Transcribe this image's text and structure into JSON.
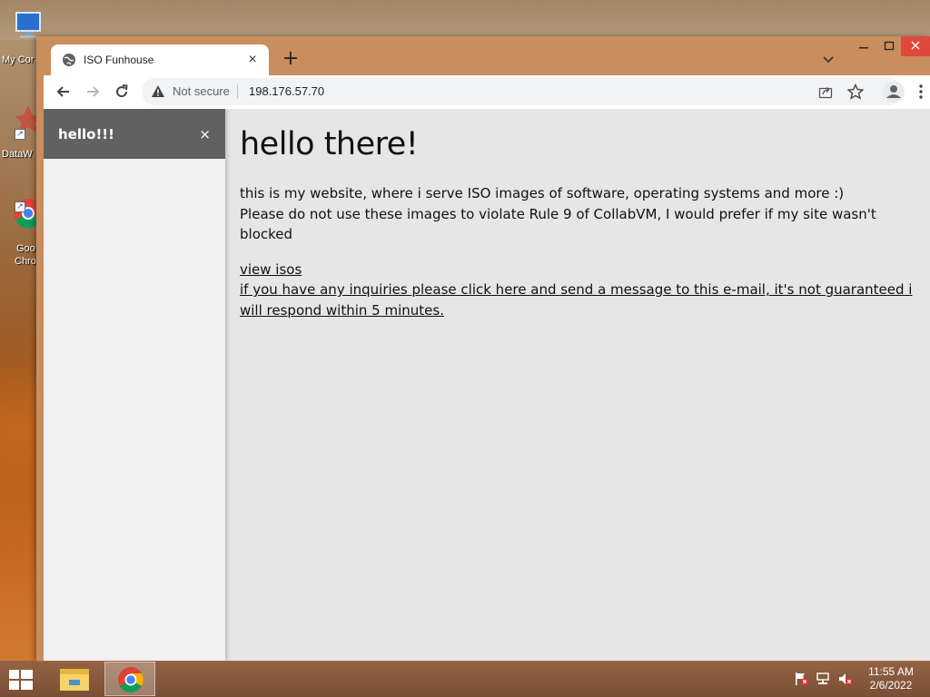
{
  "desktop": {
    "icons": [
      {
        "label": "My Cor"
      },
      {
        "label": "DataW"
      },
      {
        "label": "Goo",
        "label2": "Chro"
      }
    ]
  },
  "browser": {
    "tab_title": "ISO Funhouse",
    "address": {
      "security_label": "Not secure",
      "url": "198.176.57.70"
    }
  },
  "page": {
    "sidenav": {
      "title": "hello!!!",
      "close_glyph": "×"
    },
    "heading": "hello there!",
    "intro_line1": "this is my website, where i serve ISO images of software, operating systems and more :)",
    "intro_line2": "Please do not use these images to violate Rule 9 of CollabVM, I would prefer if my site wasn't blocked",
    "links": [
      {
        "label": "view isos"
      },
      {
        "label": "if you have any inquiries please click here and send a message to this e-mail, it's not guaranteed i will respond within 5 minutes."
      }
    ]
  },
  "taskbar": {
    "time": "11:55 AM",
    "date": "2/6/2022"
  },
  "colors": {
    "accent_close": "#e0483c",
    "sidenav_header": "#616161",
    "page_bg": "#e6e6e6"
  }
}
